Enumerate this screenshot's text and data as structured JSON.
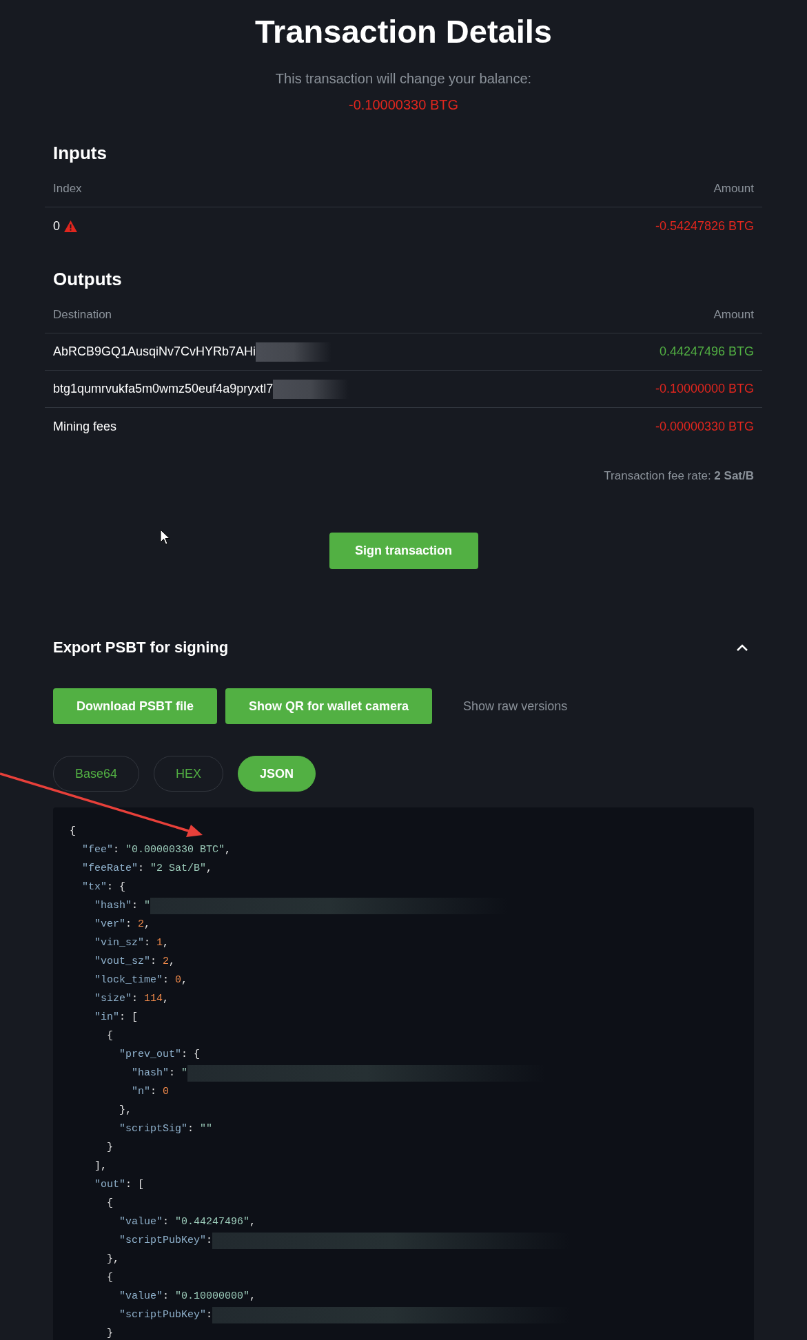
{
  "title": "Transaction Details",
  "balance": {
    "label": "This transaction will change your balance:",
    "amount": "-0.10000330 BTG"
  },
  "inputs": {
    "heading": "Inputs",
    "columns": [
      "Index",
      "Amount"
    ],
    "rows": [
      {
        "index": "0",
        "warning": true,
        "amount": "-0.54247826 BTG",
        "color": "#e0261e"
      }
    ]
  },
  "outputs": {
    "heading": "Outputs",
    "columns": [
      "Destination",
      "Amount"
    ],
    "rows": [
      {
        "destination": "AbRCB9GQ1AusqiNv7CvHYRb7AHi",
        "redacted": true,
        "amount": "0.44247496 BTG",
        "color": "#52b043"
      },
      {
        "destination": "btg1qumrvukfa5m0wmz50euf4a9pryxtl7",
        "redacted": true,
        "amount": "-0.10000000 BTG",
        "color": "#e0261e"
      },
      {
        "destination": "Mining fees",
        "redacted": false,
        "amount": "-0.00000330 BTG",
        "color": "#e0261e"
      }
    ]
  },
  "fee_rate": "Transaction fee rate: **2 Sat/B**",
  "sign_button": "Sign transaction",
  "export": {
    "heading": "Export PSBT for signing",
    "expanded": true,
    "buttons": [
      "Download PSBT file",
      "Show QR for wallet camera"
    ],
    "raw_link": "Show raw versions",
    "tabs": [
      {
        "label": "Base64",
        "selected": false
      },
      {
        "label": "HEX",
        "selected": false
      },
      {
        "label": "JSON",
        "selected": true
      }
    ],
    "code": [
      {
        "tokens": [
          {
            "kind": "punct",
            "text": "{"
          }
        ]
      },
      {
        "tokens": [
          {
            "kind": "key",
            "text": "  \"fee\""
          },
          {
            "kind": "punct",
            "text": ": "
          },
          {
            "kind": "string",
            "text": "\"0.00000330 BTC\""
          },
          {
            "kind": "punct",
            "text": ","
          }
        ]
      },
      {
        "tokens": [
          {
            "kind": "key",
            "text": "  \"feeRate\""
          },
          {
            "kind": "punct",
            "text": ": "
          },
          {
            "kind": "string",
            "text": "\"2 Sat/B\""
          },
          {
            "kind": "punct",
            "text": ","
          }
        ]
      },
      {
        "tokens": [
          {
            "kind": "key",
            "text": "  \"tx\""
          },
          {
            "kind": "punct",
            "text": ": {"
          }
        ]
      },
      {
        "tokens": [
          {
            "kind": "key",
            "text": "    \"hash\""
          },
          {
            "kind": "punct",
            "text": ": "
          },
          {
            "kind": "string",
            "text": "\""
          }
        ],
        "redacted": true
      },
      {
        "tokens": [
          {
            "kind": "key",
            "text": "    \"ver\""
          },
          {
            "kind": "punct",
            "text": ": "
          },
          {
            "kind": "number",
            "text": "2"
          },
          {
            "kind": "punct",
            "text": ","
          }
        ]
      },
      {
        "tokens": [
          {
            "kind": "key",
            "text": "    \"vin_sz\""
          },
          {
            "kind": "punct",
            "text": ": "
          },
          {
            "kind": "number",
            "text": "1"
          },
          {
            "kind": "punct",
            "text": ","
          }
        ]
      },
      {
        "tokens": [
          {
            "kind": "key",
            "text": "    \"vout_sz\""
          },
          {
            "kind": "punct",
            "text": ": "
          },
          {
            "kind": "number",
            "text": "2"
          },
          {
            "kind": "punct",
            "text": ","
          }
        ]
      },
      {
        "tokens": [
          {
            "kind": "key",
            "text": "    \"lock_time\""
          },
          {
            "kind": "punct",
            "text": ": "
          },
          {
            "kind": "number",
            "text": "0"
          },
          {
            "kind": "punct",
            "text": ","
          }
        ]
      },
      {
        "tokens": [
          {
            "kind": "key",
            "text": "    \"size\""
          },
          {
            "kind": "punct",
            "text": ": "
          },
          {
            "kind": "number",
            "text": "114"
          },
          {
            "kind": "punct",
            "text": ","
          }
        ]
      },
      {
        "tokens": [
          {
            "kind": "key",
            "text": "    \"in\""
          },
          {
            "kind": "punct",
            "text": ": ["
          }
        ]
      },
      {
        "tokens": [
          {
            "kind": "punct",
            "text": "      {"
          }
        ]
      },
      {
        "tokens": [
          {
            "kind": "key",
            "text": "        \"prev_out\""
          },
          {
            "kind": "punct",
            "text": ": {"
          }
        ]
      },
      {
        "tokens": [
          {
            "kind": "key",
            "text": "          \"hash\""
          },
          {
            "kind": "punct",
            "text": ": "
          },
          {
            "kind": "string",
            "text": "\""
          }
        ],
        "redacted": true
      },
      {
        "tokens": [
          {
            "kind": "key",
            "text": "          \"n\""
          },
          {
            "kind": "punct",
            "text": ": "
          },
          {
            "kind": "number",
            "text": "0"
          }
        ]
      },
      {
        "tokens": [
          {
            "kind": "punct",
            "text": "        },"
          }
        ]
      },
      {
        "tokens": [
          {
            "kind": "key",
            "text": "        \"scriptSig\""
          },
          {
            "kind": "punct",
            "text": ": "
          },
          {
            "kind": "string",
            "text": "\"\""
          }
        ]
      },
      {
        "tokens": [
          {
            "kind": "punct",
            "text": "      }"
          }
        ]
      },
      {
        "tokens": [
          {
            "kind": "punct",
            "text": "    ],"
          }
        ]
      },
      {
        "tokens": [
          {
            "kind": "key",
            "text": "    \"out\""
          },
          {
            "kind": "punct",
            "text": ": ["
          }
        ]
      },
      {
        "tokens": [
          {
            "kind": "punct",
            "text": "      {"
          }
        ]
      },
      {
        "tokens": [
          {
            "kind": "key",
            "text": "        \"value\""
          },
          {
            "kind": "punct",
            "text": ": "
          },
          {
            "kind": "string",
            "text": "\"0.44247496\""
          },
          {
            "kind": "punct",
            "text": ","
          }
        ]
      },
      {
        "tokens": [
          {
            "kind": "key",
            "text": "        \"scriptPubKey\""
          },
          {
            "kind": "punct",
            "text": ":"
          }
        ],
        "redacted": true
      },
      {
        "tokens": [
          {
            "kind": "punct",
            "text": "      },"
          }
        ]
      },
      {
        "tokens": [
          {
            "kind": "punct",
            "text": "      {"
          }
        ]
      },
      {
        "tokens": [
          {
            "kind": "key",
            "text": "        \"value\""
          },
          {
            "kind": "punct",
            "text": ": "
          },
          {
            "kind": "string",
            "text": "\"0.10000000\""
          },
          {
            "kind": "punct",
            "text": ","
          }
        ]
      },
      {
        "tokens": [
          {
            "kind": "key",
            "text": "        \"scriptPubKey\""
          },
          {
            "kind": "punct",
            "text": ":"
          }
        ],
        "redacted": true
      },
      {
        "tokens": [
          {
            "kind": "punct",
            "text": "      }"
          }
        ]
      }
    ]
  }
}
